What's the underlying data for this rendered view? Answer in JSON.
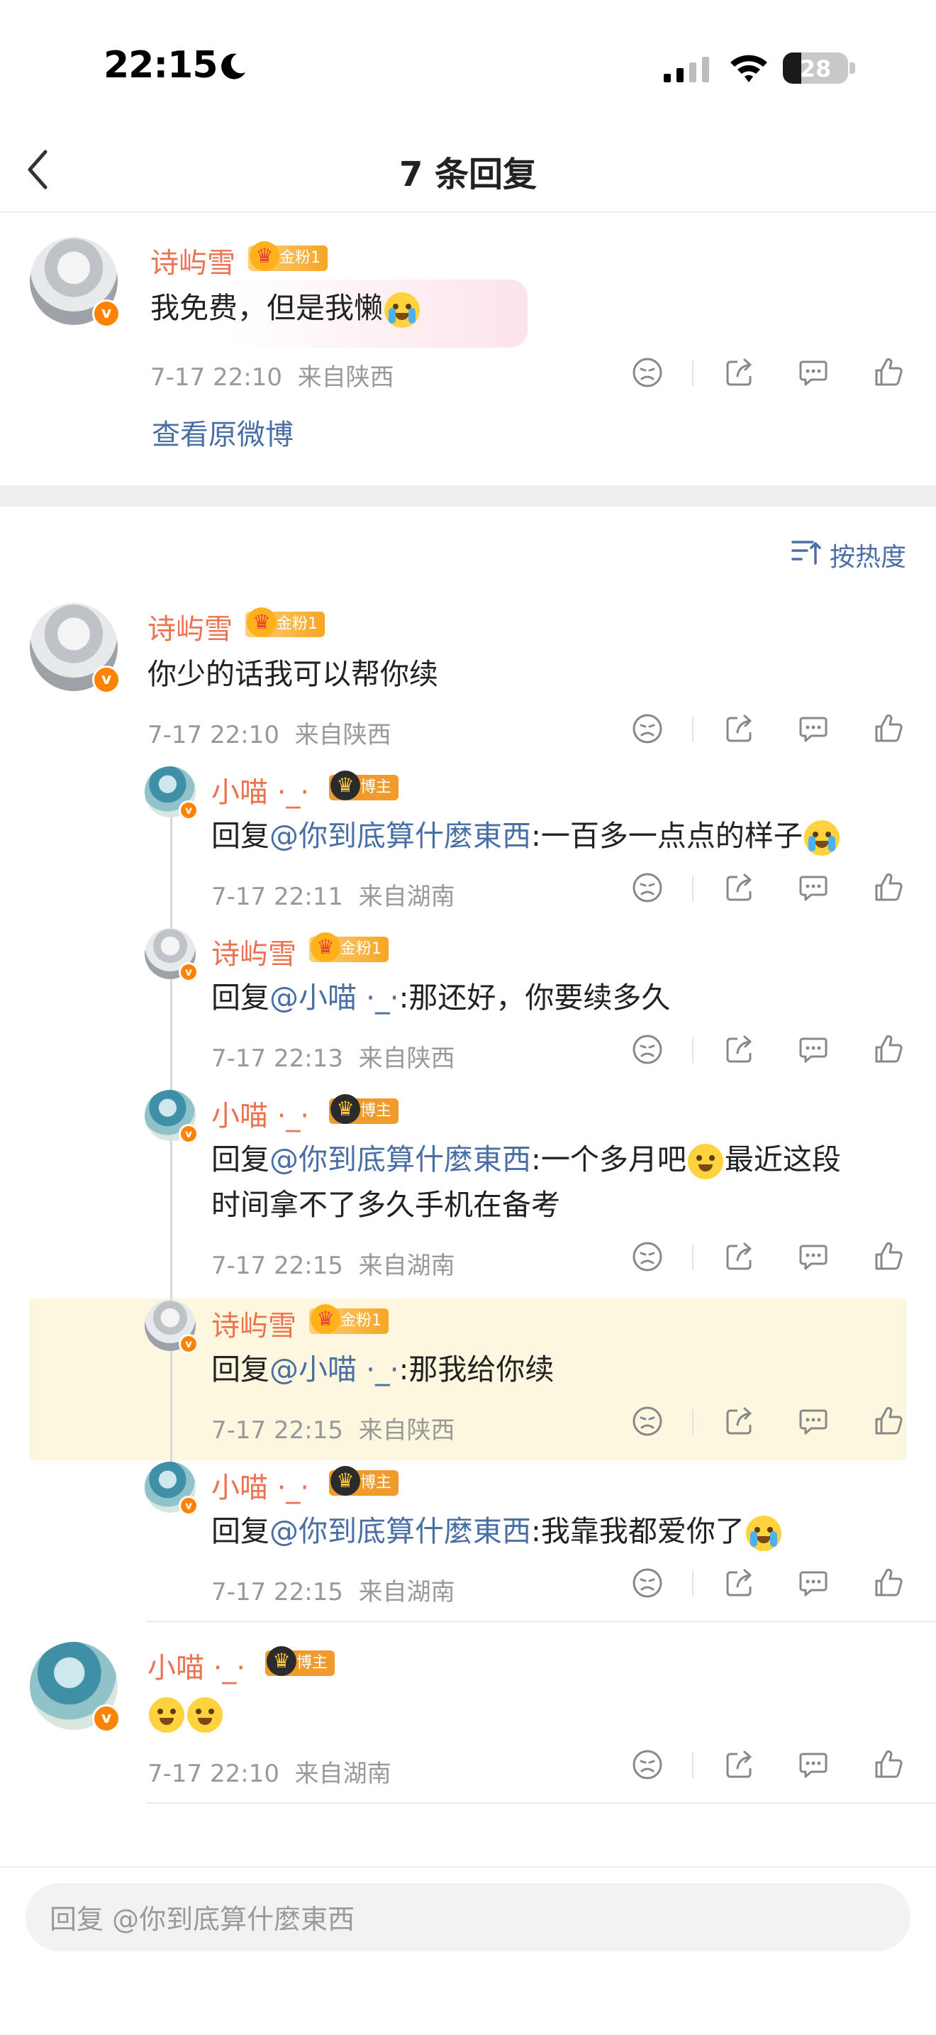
{
  "status_bar": {
    "time": "22:15",
    "battery": "28"
  },
  "nav": {
    "title": "7 条回复"
  },
  "original": {
    "user": "诗屿雪",
    "badge": "金粉1",
    "text": "我免费，但是我懒",
    "time": "7-17 22:10",
    "source": "来自陕西",
    "view_original": "查看原微博"
  },
  "sort_label": "按热度",
  "comments": [
    {
      "user": "诗屿雪",
      "badge": "金粉1",
      "text": "你少的话我可以帮你续",
      "time": "7-17 22:10",
      "source": "来自陕西"
    },
    {
      "user": "小喵 ·_·",
      "badge": "博主",
      "prefix": "回复",
      "mention": "@你到底算什麼東西",
      "text": ":一百多一点点的样子",
      "time": "7-17 22:11",
      "source": "来自湖南"
    },
    {
      "user": "诗屿雪",
      "badge": "金粉1",
      "prefix": "回复",
      "mention": "@小喵 ·_·",
      "text": ":那还好，你要续多久",
      "time": "7-17 22:13",
      "source": "来自陕西"
    },
    {
      "user": "小喵 ·_·",
      "badge": "博主",
      "prefix": "回复",
      "mention": "@你到底算什麼東西",
      "text": ":一个多月吧",
      "text2": "最近这段",
      "line2": "时间拿不了多久手机在备考",
      "time": "7-17 22:15",
      "source": "来自湖南"
    },
    {
      "user": "诗屿雪",
      "badge": "金粉1",
      "prefix": "回复",
      "mention": "@小喵 ·_·",
      "text": ":那我给你续",
      "time": "7-17 22:15",
      "source": "来自陕西"
    },
    {
      "user": "小喵 ·_·",
      "badge": "博主",
      "prefix": "回复",
      "mention": "@你到底算什麼東西",
      "text": ":我靠我都爱你了",
      "time": "7-17 22:15",
      "source": "来自湖南"
    },
    {
      "user": "小喵 ·_·",
      "badge": "博主",
      "text": "",
      "time": "7-17 22:10",
      "source": "来自湖南"
    }
  ],
  "reply_bar": {
    "placeholder": "回复 @你到底算什麼東西"
  },
  "colors": {
    "name": "#eb7350",
    "link": "#4a6fa5",
    "highlight": "#fdf7df",
    "verified": "#ff8200"
  }
}
